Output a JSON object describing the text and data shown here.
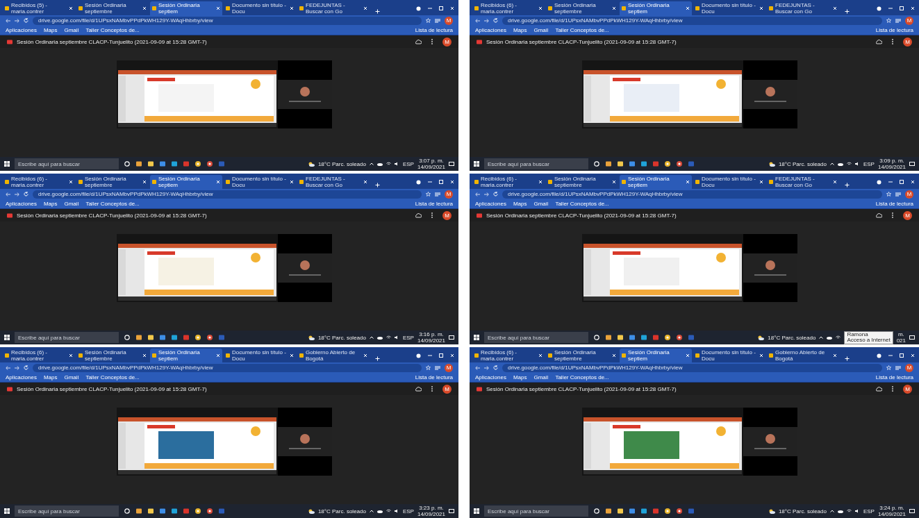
{
  "panels": [
    {
      "tabs": [
        {
          "label": "Recibidos (5) - maria.contrer",
          "selected": false
        },
        {
          "label": "Sesión Ordinaria septiembre",
          "selected": false
        },
        {
          "label": "Sesión Ordinaria septiem",
          "selected": true
        },
        {
          "label": "Documento sin título - Docu",
          "selected": false
        },
        {
          "label": "FEDEJUNTAS - Buscar con Go",
          "selected": false
        }
      ],
      "url": "drive.google.com/file/d/1UPsxNAMbvPPdPkWH129Y-WAqHhbrby/view",
      "bookmarks": [
        "Aplicaciones",
        "Maps",
        "Gmail",
        "Taller Conceptos de..."
      ],
      "reading_list": "Lista de lectura",
      "avatar": "M",
      "video_title": "Sesión Ordinaria septiembre CLACP-Tunjuelito (2021-09-09 at 15:28 GMT-7)",
      "video_avatar": "M",
      "taskbar": {
        "search_placeholder": "Escribe aquí para buscar",
        "weather": "18°C  Parc. soleado",
        "lang": "ESP",
        "time": "3:07 p. m.",
        "date": "14/09/2021"
      }
    },
    {
      "tabs": [
        {
          "label": "Recibidos (6) - maria.contrer",
          "selected": false
        },
        {
          "label": "Sesión Ordinaria septiembre",
          "selected": false
        },
        {
          "label": "Sesión Ordinaria septiem",
          "selected": true
        },
        {
          "label": "Documento sin título - Docu",
          "selected": false
        },
        {
          "label": "FEDEJUNTAS - Buscar con Go",
          "selected": false
        }
      ],
      "url": "drive.google.com/file/d/1UPsxNAMbvPPdPkWH129Y-WAqHhbrby/view",
      "bookmarks": [
        "Aplicaciones",
        "Maps",
        "Gmail",
        "Taller Conceptos de..."
      ],
      "reading_list": "Lista de lectura",
      "avatar": "M",
      "video_title": "Sesión Ordinaria septiembre CLACP-Tunjuelito (2021-09-09 at 15:28 GMT-7)",
      "video_avatar": "M",
      "taskbar": {
        "search_placeholder": "Escribe aquí para buscar",
        "weather": "18°C  Parc. soleado",
        "lang": "ESP",
        "time": "3:09 p. m.",
        "date": "14/09/2021"
      }
    },
    {
      "tabs": [
        {
          "label": "Recibidos (6) - maria.contrer",
          "selected": false
        },
        {
          "label": "Sesión Ordinaria septiembre",
          "selected": false
        },
        {
          "label": "Sesión Ordinaria septiem",
          "selected": true
        },
        {
          "label": "Documento sin título - Docu",
          "selected": false
        },
        {
          "label": "FEDEJUNTAS - Buscar con Go",
          "selected": false
        }
      ],
      "url": "drive.google.com/file/d/1UPsxNAMbvPPdPkWH129Y-WAqHhbrby/view",
      "bookmarks": [
        "Aplicaciones",
        "Maps",
        "Gmail",
        "Taller Conceptos de..."
      ],
      "reading_list": "Lista de lectura",
      "avatar": "M",
      "video_title": "Sesión Ordinaria septiembre CLACP-Tunjuelito (2021-09-09 at 15:28 GMT-7)",
      "video_avatar": "M",
      "taskbar": {
        "search_placeholder": "Escribe aquí para buscar",
        "weather": "18°C  Parc. soleado",
        "lang": "ESP",
        "time": "3:16 p. m.",
        "date": "14/09/2021"
      }
    },
    {
      "tabs": [
        {
          "label": "Recibidos (6) - maria.contrer",
          "selected": false
        },
        {
          "label": "Sesión Ordinaria septiembre",
          "selected": false
        },
        {
          "label": "Sesión Ordinaria septiem",
          "selected": true
        },
        {
          "label": "Documento sin título - Docu",
          "selected": false
        },
        {
          "label": "FEDEJUNTAS - Buscar con Go",
          "selected": false
        }
      ],
      "url": "drive.google.com/file/d/1UPsxNAMbvPPdPkWH129Y-WAqHhbrby/view",
      "bookmarks": [
        "Aplicaciones",
        "Maps",
        "Gmail",
        "Taller Conceptos de..."
      ],
      "reading_list": "Lista de lectura",
      "avatar": "M",
      "video_title": "Sesión Ordinaria septiembre CLACP-Tunjuelito (2021-09-09 at 15:28 GMT-7)",
      "video_avatar": "M",
      "taskbar": {
        "search_placeholder": "Escribe aquí para buscar",
        "weather": "18°C  Parc. soleado",
        "time": "m.",
        "date": "021",
        "tooltip": {
          "title": "Ramona",
          "subtitle": "Acceso a Internet"
        }
      }
    },
    {
      "tabs": [
        {
          "label": "Recibidos (6) - maria.contrer",
          "selected": false
        },
        {
          "label": "Sesión Ordinaria septiembre",
          "selected": false
        },
        {
          "label": "Sesión Ordinaria septiem",
          "selected": true
        },
        {
          "label": "Documento sin título - Docu",
          "selected": false
        },
        {
          "label": "Gobierno Abierto de Bogotá",
          "selected": false
        }
      ],
      "url": "drive.google.com/file/d/1UPsxNAMbvPPdPkWH129Y-WAqHhbrby/view",
      "bookmarks": [
        "Aplicaciones",
        "Maps",
        "Gmail",
        "Taller Conceptos de..."
      ],
      "reading_list": "Lista de lectura",
      "avatar": "M",
      "video_title": "Sesión Ordinaria septiembre CLACP-Tunjuelito (2021-09-09 at 15:28 GMT-7)",
      "video_avatar": "M",
      "taskbar": {
        "search_placeholder": "Escribe aquí para buscar",
        "weather": "18°C  Parc. soleado",
        "lang": "ESP",
        "time": "3:23 p. m.",
        "date": "14/09/2021"
      }
    },
    {
      "tabs": [
        {
          "label": "Recibidos (6) - maria.contrer",
          "selected": false
        },
        {
          "label": "Sesión Ordinaria septiembre",
          "selected": false
        },
        {
          "label": "Sesión Ordinaria septiem",
          "selected": true
        },
        {
          "label": "Documento sin título - Docu",
          "selected": false
        },
        {
          "label": "Gobierno Abierto de Bogotá",
          "selected": false
        }
      ],
      "url": "drive.google.com/file/d/1UPsxNAMbvPPdPkWH129Y-WAqHhbrby/view",
      "bookmarks": [
        "Aplicaciones",
        "Maps",
        "Gmail",
        "Taller Conceptos de..."
      ],
      "reading_list": "Lista de lectura",
      "avatar": "M",
      "video_title": "Sesión Ordinaria septiembre CLACP-Tunjuelito (2021-09-09 at 15:28 GMT-7)",
      "video_avatar": "M",
      "taskbar": {
        "search_placeholder": "Escribe aquí para buscar",
        "weather": "18°C  Parc. soleado",
        "lang": "ESP",
        "time": "3:24 p. m.",
        "date": "14/09/2021"
      }
    }
  ]
}
